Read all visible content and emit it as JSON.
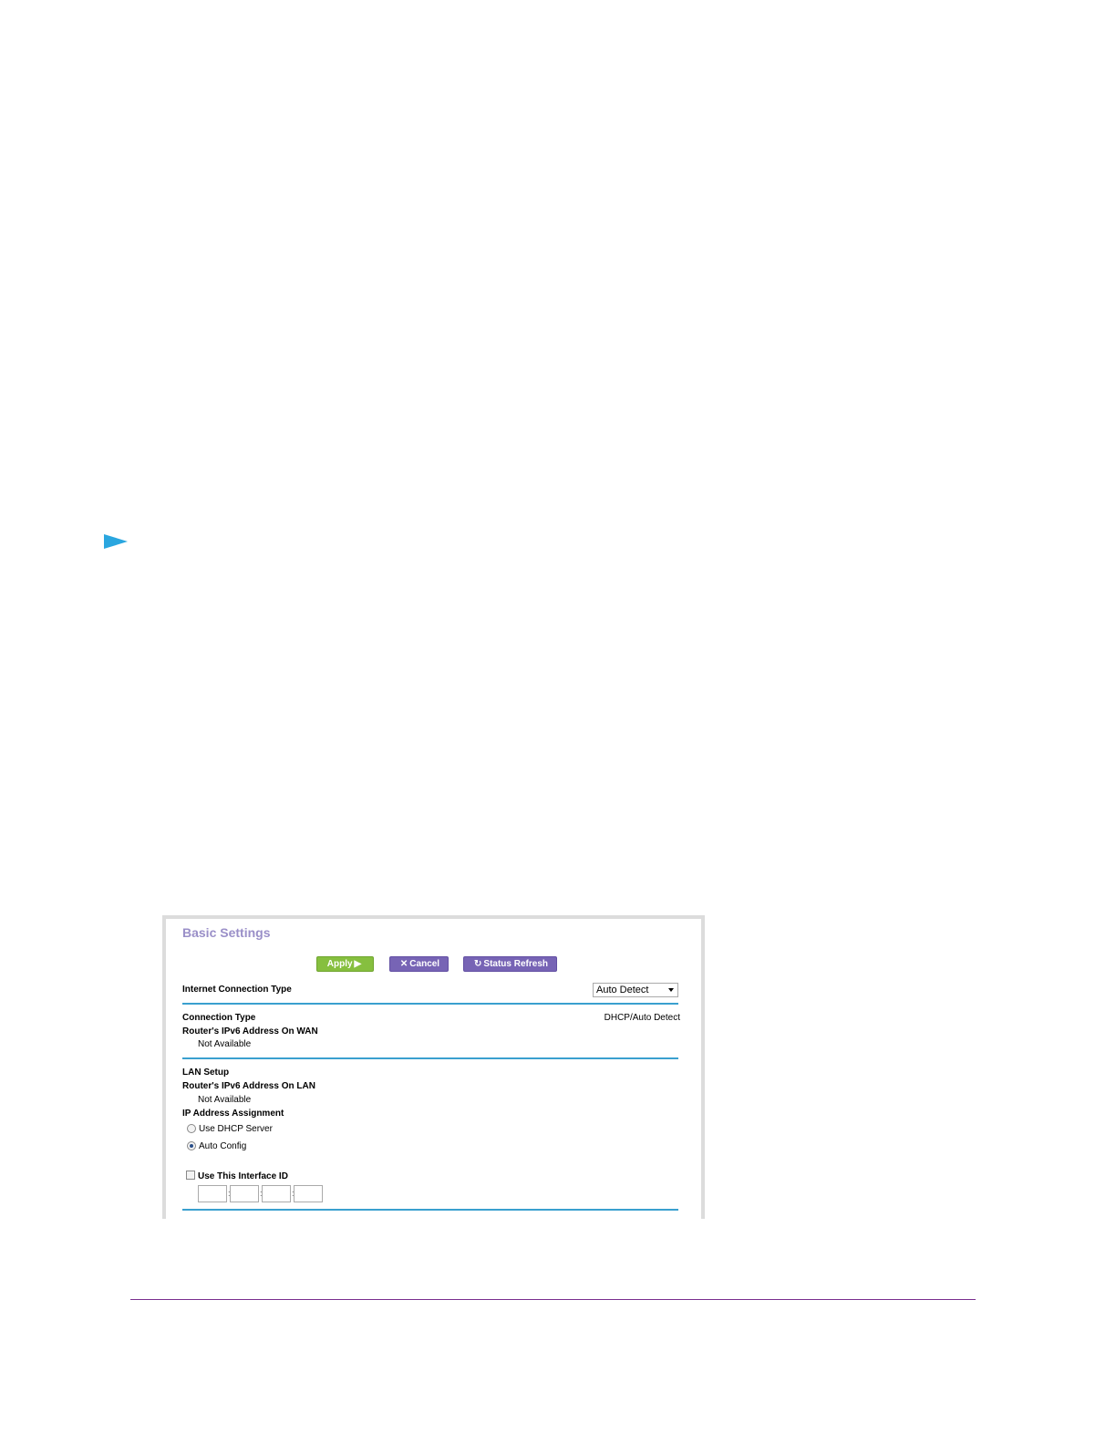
{
  "panel": {
    "title": "Basic Settings",
    "buttons": {
      "apply": "Apply",
      "cancel": "Cancel",
      "refresh": "Status Refresh"
    },
    "internet_connection_type": {
      "label": "Internet Connection Type",
      "selected": "Auto Detect"
    },
    "connection_type": {
      "label": "Connection Type",
      "value": "DHCP/Auto Detect"
    },
    "wan_address": {
      "label": "Router's IPv6 Address On WAN",
      "value": "Not Available"
    },
    "lan_setup": {
      "label": "LAN Setup"
    },
    "lan_address": {
      "label": "Router's IPv6 Address On LAN",
      "value": "Not Available"
    },
    "ip_assignment": {
      "label": "IP Address Assignment",
      "options": [
        "Use DHCP Server",
        "Auto Config"
      ],
      "selected_index": 1
    },
    "interface_id": {
      "label": "Use This Interface ID",
      "checked": false,
      "fields": [
        "",
        "",
        "",
        ""
      ]
    }
  },
  "colors": {
    "accent_rule": "#3aa0cf",
    "apply_button": "#86bf3f",
    "purple_button": "#7764b5",
    "title": "#9a8fc8",
    "arrow_marker": "#2aa6df",
    "footer_rule": "#7a2e8e"
  },
  "icons": {
    "apply": "play-icon",
    "cancel": "x-icon",
    "refresh": "refresh-icon",
    "marker": "arrow-marker-icon"
  }
}
